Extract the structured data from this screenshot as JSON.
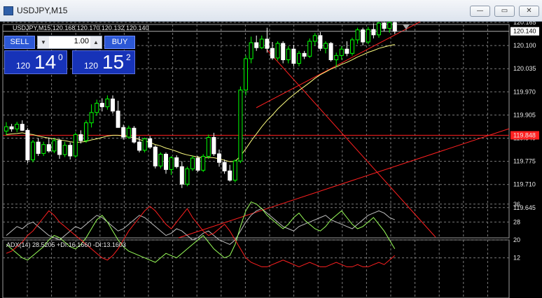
{
  "window": {
    "title": "USDJPY,M15",
    "buttons": {
      "minimize": "—",
      "restore": "▭",
      "close": "✕"
    }
  },
  "chart_header": "USDJPY,M15  120.168 120.170 120.132 120.140",
  "trade_panel": {
    "sell_label": "SELL",
    "buy_label": "BUY",
    "lot_value": "1.00",
    "sell_price": {
      "prefix": "120",
      "big": "14",
      "sup": "0"
    },
    "buy_price": {
      "prefix": "120",
      "big": "15",
      "sup": "2"
    }
  },
  "price_axis": {
    "labels": [
      "120.165",
      "120.100",
      "120.035",
      "119.970",
      "119.905",
      "119.840",
      "119.775",
      "119.710",
      "119.645"
    ],
    "current_price": "120.140",
    "red_line_price": "119.848"
  },
  "indicator": {
    "header": "ADX(14) 28.5205 +DI:16.1660 -DI:13.1603",
    "scale_labels": [
      "36",
      "28",
      "20",
      "12"
    ]
  },
  "colors": {
    "bull_candle": "#00ff00",
    "bear_candle": "#ffffff",
    "ma_line": "#ffff80",
    "trend_lines": "#ff2020",
    "grid": "#7a7a7a",
    "adx": "#c0c0c0",
    "plus_di": "#9aff5a",
    "minus_di": "#ff2020"
  },
  "chart_data": {
    "type": "candlestick",
    "symbol": "USDJPY",
    "timeframe": "M15",
    "ohlc": [
      [
        119.86,
        119.885,
        119.848,
        119.872
      ],
      [
        119.872,
        119.88,
        119.858,
        119.866
      ],
      [
        119.866,
        119.886,
        119.857,
        119.879
      ],
      [
        119.879,
        119.89,
        119.86,
        119.862
      ],
      [
        119.862,
        119.868,
        119.77,
        119.779
      ],
      [
        119.779,
        119.835,
        119.772,
        119.829
      ],
      [
        119.829,
        119.84,
        119.79,
        119.797
      ],
      [
        119.797,
        119.83,
        119.79,
        119.822
      ],
      [
        119.822,
        119.842,
        119.799,
        119.804
      ],
      [
        119.804,
        119.84,
        119.798,
        119.833
      ],
      [
        119.833,
        119.838,
        119.782,
        119.794
      ],
      [
        119.794,
        119.83,
        119.787,
        119.82
      ],
      [
        119.82,
        119.828,
        119.78,
        119.79
      ],
      [
        119.79,
        119.856,
        119.785,
        119.85
      ],
      [
        119.85,
        119.862,
        119.825,
        119.833
      ],
      [
        119.833,
        119.89,
        119.827,
        119.883
      ],
      [
        119.883,
        119.935,
        119.87,
        119.912
      ],
      [
        119.912,
        119.948,
        119.903,
        119.938
      ],
      [
        119.938,
        119.952,
        119.915,
        119.928
      ],
      [
        119.928,
        119.96,
        119.92,
        119.95
      ],
      [
        119.95,
        119.96,
        119.909,
        119.916
      ],
      [
        119.916,
        119.945,
        119.87,
        119.87
      ],
      [
        119.87,
        119.878,
        119.836,
        119.843
      ],
      [
        119.843,
        119.875,
        119.838,
        119.868
      ],
      [
        119.868,
        119.874,
        119.825,
        119.829
      ],
      [
        119.829,
        119.845,
        119.8,
        119.806
      ],
      [
        119.806,
        119.842,
        119.8,
        119.838
      ],
      [
        119.838,
        119.846,
        119.81,
        119.815
      ],
      [
        119.815,
        119.82,
        119.755,
        119.762
      ],
      [
        119.762,
        119.8,
        119.755,
        119.795
      ],
      [
        119.795,
        119.8,
        119.74,
        119.752
      ],
      [
        119.752,
        119.79,
        119.737,
        119.785
      ],
      [
        119.785,
        119.792,
        119.755,
        119.76
      ],
      [
        119.76,
        119.775,
        119.7,
        119.711
      ],
      [
        119.711,
        119.76,
        119.705,
        119.754
      ],
      [
        119.754,
        119.79,
        119.748,
        119.784
      ],
      [
        119.784,
        119.79,
        119.745,
        119.75
      ],
      [
        119.75,
        119.795,
        119.745,
        119.789
      ],
      [
        119.789,
        119.85,
        119.782,
        119.842
      ],
      [
        119.842,
        119.855,
        119.79,
        119.796
      ],
      [
        119.796,
        119.808,
        119.76,
        119.772
      ],
      [
        119.772,
        119.78,
        119.74,
        119.748
      ],
      [
        119.748,
        119.765,
        119.718,
        119.722
      ],
      [
        119.722,
        119.78,
        119.716,
        119.776
      ],
      [
        119.776,
        119.985,
        119.77,
        119.975
      ],
      [
        119.975,
        120.072,
        119.96,
        120.063
      ],
      [
        120.063,
        120.125,
        120.05,
        120.108
      ],
      [
        120.108,
        120.128,
        120.085,
        120.094
      ],
      [
        120.094,
        120.128,
        120.09,
        120.118
      ],
      [
        120.118,
        120.15,
        120.08,
        120.092
      ],
      [
        120.092,
        120.11,
        120.06,
        120.065
      ],
      [
        120.065,
        120.112,
        120.058,
        120.106
      ],
      [
        120.106,
        120.112,
        120.05,
        120.06
      ],
      [
        120.06,
        120.098,
        120.05,
        120.09
      ],
      [
        120.09,
        120.102,
        120.042,
        120.05
      ],
      [
        120.05,
        120.085,
        120.042,
        120.078
      ],
      [
        120.078,
        120.085,
        120.062,
        120.07
      ],
      [
        120.07,
        120.12,
        120.065,
        120.112
      ],
      [
        120.112,
        120.135,
        120.1,
        120.128
      ],
      [
        120.128,
        120.138,
        120.085,
        120.092
      ],
      [
        120.092,
        120.112,
        120.078,
        120.106
      ],
      [
        120.106,
        120.11,
        120.055,
        120.06
      ],
      [
        120.06,
        120.08,
        120.04,
        120.072
      ],
      [
        120.072,
        120.098,
        120.06,
        120.09
      ],
      [
        120.09,
        120.112,
        120.07,
        120.078
      ],
      [
        120.078,
        120.122,
        120.072,
        120.116
      ],
      [
        120.116,
        120.15,
        120.105,
        120.144
      ],
      [
        120.144,
        120.15,
        120.1,
        120.11
      ],
      [
        120.11,
        120.152,
        120.104,
        120.145
      ],
      [
        120.145,
        120.162,
        120.12,
        120.13
      ],
      [
        120.13,
        120.17,
        120.122,
        120.163
      ],
      [
        120.163,
        120.175,
        120.14,
        120.148
      ],
      [
        120.148,
        120.172,
        120.136,
        120.165
      ],
      [
        120.165,
        120.17,
        120.132,
        120.14
      ]
    ],
    "moving_average": [
      119.85,
      119.852,
      119.853,
      119.855,
      119.852,
      119.85,
      119.846,
      119.843,
      119.84,
      119.838,
      119.835,
      119.833,
      119.83,
      119.828,
      119.829,
      119.831,
      119.835,
      119.838,
      119.842,
      119.846,
      119.848,
      119.848,
      119.846,
      119.844,
      119.841,
      119.836,
      119.832,
      119.828,
      119.822,
      119.818,
      119.812,
      119.808,
      119.803,
      119.797,
      119.793,
      119.79,
      119.787,
      119.785,
      119.786,
      119.785,
      119.782,
      119.778,
      119.774,
      119.775,
      119.79,
      119.81,
      119.832,
      119.852,
      119.872,
      119.89,
      119.905,
      119.922,
      119.936,
      119.95,
      119.962,
      119.974,
      119.985,
      119.996,
      120.008,
      120.018,
      120.026,
      120.034,
      120.04,
      120.047,
      120.053,
      120.06,
      120.068,
      120.074,
      120.081,
      120.086,
      120.092,
      120.096,
      120.1,
      120.103
    ],
    "adx": [
      22,
      24,
      26,
      25,
      27,
      28,
      26,
      24,
      22,
      21,
      20,
      22,
      24,
      26,
      25,
      27,
      29,
      31,
      30,
      28,
      26,
      24,
      25,
      27,
      29,
      31,
      30,
      28,
      26,
      24,
      22,
      23,
      25,
      24,
      22,
      20,
      21,
      23,
      24,
      22,
      20,
      19,
      18,
      20,
      24,
      28,
      31,
      33,
      34,
      32,
      30,
      28,
      26,
      25,
      24,
      26,
      27,
      28,
      29,
      30,
      31,
      29,
      28,
      27,
      26,
      25,
      27,
      29,
      31,
      32,
      33,
      32,
      30,
      29
    ],
    "plus_di": [
      18,
      16,
      14,
      12,
      11,
      13,
      15,
      17,
      20,
      22,
      21,
      19,
      17,
      16,
      18,
      21,
      25,
      29,
      31,
      28,
      24,
      20,
      17,
      15,
      14,
      13,
      12,
      11,
      10,
      12,
      14,
      13,
      12,
      14,
      16,
      18,
      20,
      22,
      19,
      16,
      14,
      12,
      13,
      18,
      26,
      33,
      37,
      36,
      34,
      31,
      29,
      27,
      25,
      27,
      30,
      32,
      29,
      27,
      25,
      24,
      26,
      29,
      31,
      33,
      30,
      27,
      25,
      26,
      28,
      30,
      27,
      24,
      20,
      16
    ],
    "minus_di": [
      14,
      15,
      17,
      19,
      22,
      24,
      27,
      30,
      33,
      31,
      28,
      26,
      24,
      22,
      20,
      18,
      16,
      14,
      12,
      11,
      13,
      16,
      20,
      24,
      27,
      30,
      33,
      35,
      33,
      30,
      27,
      25,
      28,
      31,
      34,
      30,
      27,
      24,
      22,
      23,
      25,
      27,
      24,
      20,
      16,
      12,
      10,
      9,
      8,
      8,
      9,
      10,
      11,
      10,
      9,
      8,
      9,
      10,
      9,
      8,
      8,
      9,
      10,
      9,
      8,
      8,
      9,
      8,
      8,
      9,
      10,
      9,
      11,
      13
    ],
    "price_ylim": [
      119.645,
      120.2
    ],
    "adx_ylim": [
      6,
      38
    ]
  }
}
